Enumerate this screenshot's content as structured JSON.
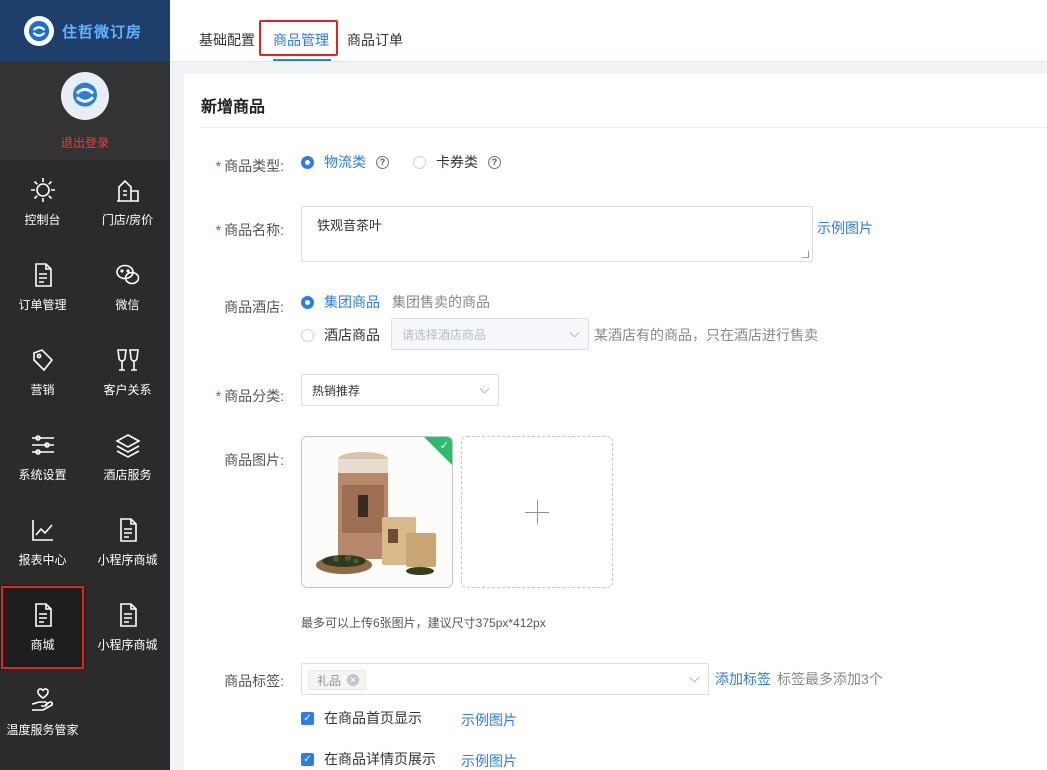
{
  "brand": {
    "name": "住哲微订房"
  },
  "user": {
    "logout_label": "退出登录"
  },
  "nav": {
    "items": [
      {
        "label": "控制台",
        "icon": "sun-icon"
      },
      {
        "label": "门店/房价",
        "icon": "building-icon"
      },
      {
        "label": "订单管理",
        "icon": "document-icon"
      },
      {
        "label": "微信",
        "icon": "wechat-icon"
      },
      {
        "label": "营销",
        "icon": "tag-icon"
      },
      {
        "label": "客户关系",
        "icon": "cheers-icon"
      },
      {
        "label": "系统设置",
        "icon": "sliders-icon"
      },
      {
        "label": "酒店服务",
        "icon": "layers-icon"
      },
      {
        "label": "报表中心",
        "icon": "chart-line-icon"
      },
      {
        "label": "小程序商城",
        "icon": "document-icon"
      },
      {
        "label": "商城",
        "icon": "document-icon",
        "active": true
      },
      {
        "label": "小程序商城",
        "icon": "document-icon"
      },
      {
        "label": "温度服务管家",
        "icon": "hand-heart-icon"
      }
    ]
  },
  "tabs": [
    {
      "label": "基础配置"
    },
    {
      "label": "商品管理",
      "active": true
    },
    {
      "label": "商品订单"
    }
  ],
  "form": {
    "title": "新增商品",
    "type": {
      "label": "商品类型:",
      "options": [
        {
          "label": "物流类",
          "checked": true
        },
        {
          "label": "卡券类",
          "checked": false
        }
      ]
    },
    "name": {
      "label": "商品名称:",
      "value": "铁观音茶叶",
      "example_link": "示例图片"
    },
    "hotel": {
      "label": "商品酒店:",
      "group_option": "集团商品",
      "group_hint": "集团售卖的商品",
      "hotel_option": "酒店商品",
      "hotel_select_placeholder": "请选择酒店商品",
      "hotel_hint": "某酒店有的商品，只在酒店进行售卖"
    },
    "category": {
      "label": "商品分类:",
      "value": "热销推荐"
    },
    "images": {
      "label": "商品图片:",
      "tip": "最多可以上传6张图片，建议尺寸375px*412px"
    },
    "tags": {
      "label": "商品标签:",
      "values": [
        "礼品"
      ],
      "add_link": "添加标签",
      "hint": "标签最多添加3个"
    },
    "show_home": {
      "label": "在商品首页显示",
      "checked": true,
      "example_link": "示例图片"
    },
    "show_detail": {
      "label": "在商品详情页展示",
      "checked": true,
      "example_link": "示例图片"
    }
  },
  "colors": {
    "accent": "#2d7de3",
    "required": "#e0433e",
    "highlight_box": "#e0241f",
    "sidebar": "#2b2b2b",
    "brand_bg": "#1f3f6b"
  }
}
